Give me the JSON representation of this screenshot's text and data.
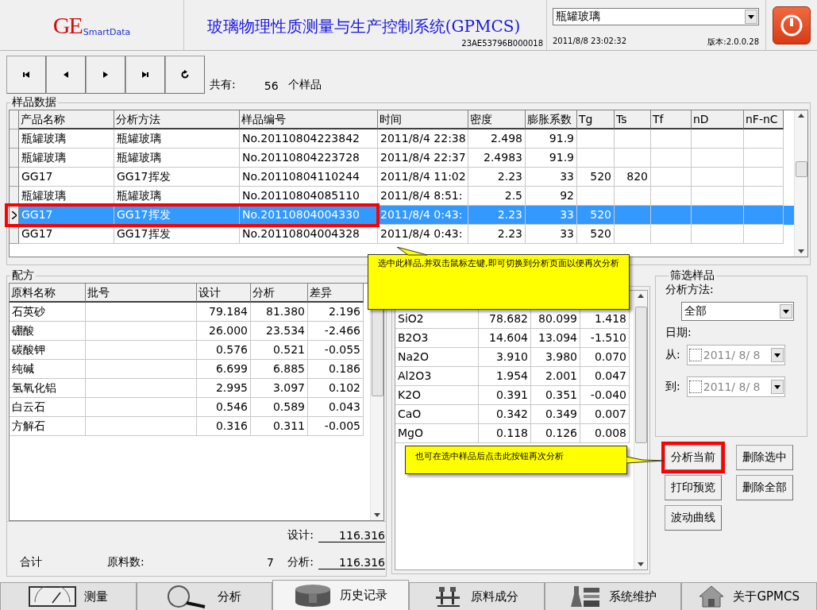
{
  "header": {
    "logo": {
      "mark": "GE",
      "brand": "SmartData"
    },
    "title": "玻璃物理性质测量与生产控制系统(GPMCS)",
    "serial": "23AE53796B000018",
    "product_select": {
      "value": "瓶罐玻璃"
    },
    "datetime": "2011/8/8 23:02:32",
    "version": "版本:2.0.0.28"
  },
  "navigator": {
    "buttons": [
      {
        "kind": "first"
      },
      {
        "kind": "prev"
      },
      {
        "kind": "next"
      },
      {
        "kind": "last"
      },
      {
        "kind": "refresh"
      }
    ],
    "total_label": "共有:",
    "count": "56",
    "unit": "个样品"
  },
  "samples": {
    "title": "样品数据",
    "columns": [
      "产品名称",
      "分析方法",
      "样品编号",
      "时间",
      "密度",
      "膨胀系数",
      "Tg",
      "Ts",
      "Tf",
      "nD",
      "nF-nC"
    ],
    "rows": [
      {
        "selected": false,
        "cells": [
          "瓶罐玻璃",
          "瓶罐玻璃",
          "No.20110804223842",
          "2011/8/4 22:38",
          "2.498",
          "91.9",
          "",
          "",
          "",
          "",
          ""
        ]
      },
      {
        "selected": false,
        "cells": [
          "瓶罐玻璃",
          "瓶罐玻璃",
          "No.20110804223728",
          "2011/8/4 22:37",
          "2.4983",
          "91.9",
          "",
          "",
          "",
          "",
          ""
        ]
      },
      {
        "selected": false,
        "cells": [
          "GG17",
          "GG17挥发",
          "No.20110804110244",
          "2011/8/4 11:02",
          "2.23",
          "33",
          "520",
          "820",
          "",
          "",
          ""
        ]
      },
      {
        "selected": false,
        "cells": [
          "瓶罐玻璃",
          "瓶罐玻璃",
          "No.20110804085110",
          "2011/8/4 8:51:",
          "2.5",
          "92",
          "",
          "",
          "",
          "",
          ""
        ]
      },
      {
        "selected": true,
        "cells": [
          "GG17",
          "GG17挥发",
          "No.20110804004330",
          "2011/8/4 0:43:",
          "2.23",
          "33",
          "520",
          "",
          "",
          "",
          ""
        ]
      },
      {
        "selected": false,
        "cells": [
          "GG17",
          "GG17挥发",
          "No.20110804004328",
          "2011/8/4 0:43:",
          "2.23",
          "33",
          "520",
          "",
          "",
          "",
          ""
        ]
      }
    ]
  },
  "recipe": {
    "title": "配方",
    "columns": [
      "原料名称",
      "批号",
      "设计",
      "分析",
      "差异"
    ],
    "rows": [
      [
        "石英砂",
        "",
        "79.184",
        "81.380",
        "2.196"
      ],
      [
        "硼酸",
        "",
        "26.000",
        "23.534",
        "-2.466"
      ],
      [
        "碳酸钾",
        "",
        "0.576",
        "0.521",
        "-0.055"
      ],
      [
        "纯碱",
        "",
        "6.699",
        "6.885",
        "0.186"
      ],
      [
        "氢氧化铝",
        "",
        "2.995",
        "3.097",
        "0.102"
      ],
      [
        "白云石",
        "",
        "0.546",
        "0.589",
        "0.043"
      ],
      [
        "方解石",
        "",
        "0.316",
        "0.311",
        "-0.005"
      ]
    ],
    "totals": {
      "design_label": "设计:",
      "design_value": "116.316",
      "sum_label": "合计",
      "count_label": "原料数:",
      "count": "7",
      "analysis_label": "分析:",
      "analysis_value": "116.316"
    }
  },
  "oxides": {
    "rows": [
      [
        "SiO2",
        "78.682",
        "80.099",
        "1.418"
      ],
      [
        "B2O3",
        "14.604",
        "13.094",
        "-1.510"
      ],
      [
        "Na2O",
        "3.910",
        "3.980",
        "0.070"
      ],
      [
        "Al2O3",
        "1.954",
        "2.001",
        "0.047"
      ],
      [
        "K2O",
        "0.391",
        "0.351",
        "-0.040"
      ],
      [
        "CaO",
        "0.342",
        "0.349",
        "0.007"
      ],
      [
        "MgO",
        "0.118",
        "0.126",
        "0.008"
      ]
    ]
  },
  "filter": {
    "title": "筛选样品",
    "method_label": "分析方法:",
    "method_value": "全部",
    "date_label": "日期:",
    "from_label": "从:",
    "from_value": "2011/  8/  8",
    "from_checked": false,
    "to_label": "到:",
    "to_value": "2011/  8/  8",
    "to_checked": false
  },
  "actions": [
    {
      "label": "分析当前",
      "highlighted": true
    },
    {
      "label": "删除选中",
      "highlighted": false
    },
    {
      "label": "打印预览",
      "highlighted": false
    },
    {
      "label": "删除全部",
      "highlighted": false
    },
    {
      "label": "波动曲线",
      "highlighted": false
    }
  ],
  "callouts": [
    {
      "kind": "up",
      "text": "选中此样品,并双击鼠标左键,即可切换到分析页面以便再次分析"
    },
    {
      "kind": "right",
      "text": "也可在选中样品后点击此按钮再次分析"
    }
  ],
  "tabs": [
    {
      "kind": "gauge",
      "label": "测量",
      "selected": false
    },
    {
      "kind": "magnifier",
      "label": "分析",
      "selected": false
    },
    {
      "kind": "cylinder",
      "label": "历史记录",
      "selected": true
    },
    {
      "kind": "tools",
      "label": "原料成分",
      "selected": false
    },
    {
      "kind": "flask",
      "label": "系统维护",
      "selected": false
    },
    {
      "kind": "house",
      "label": "关于GPMCS",
      "selected": false
    }
  ]
}
